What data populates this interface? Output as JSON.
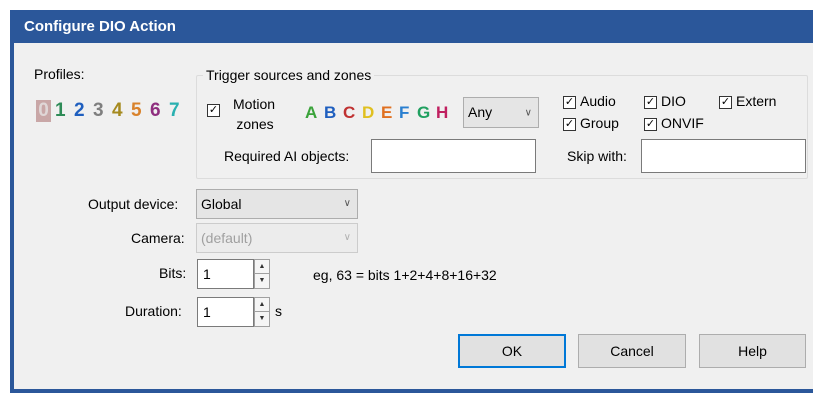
{
  "dialog": {
    "title": "Configure DIO Action"
  },
  "profiles": {
    "label": "Profiles:",
    "items": [
      {
        "label": "0",
        "color": "#e0d7d7",
        "selected": true
      },
      {
        "label": "1",
        "color": "#2e8b57"
      },
      {
        "label": "2",
        "color": "#1f5fbf"
      },
      {
        "label": "3",
        "color": "#7f7f7f"
      },
      {
        "label": "4",
        "color": "#a58a1f"
      },
      {
        "label": "5",
        "color": "#d9822b"
      },
      {
        "label": "6",
        "color": "#8f2f7f"
      },
      {
        "label": "7",
        "color": "#2ab0b0"
      }
    ]
  },
  "trigger": {
    "group_title": "Trigger sources and zones",
    "motion_zones": {
      "label_line1": "Motion",
      "label_line2": "zones",
      "checked": true
    },
    "zones": [
      {
        "label": "A",
        "color": "#3aa33a"
      },
      {
        "label": "B",
        "color": "#1f5fbf"
      },
      {
        "label": "C",
        "color": "#c03232"
      },
      {
        "label": "D",
        "color": "#e0c020"
      },
      {
        "label": "E",
        "color": "#e07020"
      },
      {
        "label": "F",
        "color": "#2a7fd0"
      },
      {
        "label": "G",
        "color": "#20a060"
      },
      {
        "label": "H",
        "color": "#c02060"
      }
    ],
    "zone_mode": {
      "value": "Any"
    },
    "sources": [
      {
        "label": "Audio",
        "checked": true
      },
      {
        "label": "DIO",
        "checked": true
      },
      {
        "label": "Extern",
        "checked": true
      },
      {
        "label": "Group",
        "checked": true
      },
      {
        "label": "ONVIF",
        "checked": true
      }
    ],
    "required_ai_label": "Required AI objects:",
    "required_ai_value": "",
    "skip_with_label": "Skip with:",
    "skip_with_value": ""
  },
  "output_device": {
    "label": "Output device:",
    "value": "Global"
  },
  "camera": {
    "label": "Camera:",
    "value": "(default)",
    "disabled": true
  },
  "bits": {
    "label": "Bits:",
    "value": "1",
    "hint": "eg, 63 = bits 1+2+4+8+16+32"
  },
  "duration": {
    "label": "Duration:",
    "value": "1",
    "unit": "s"
  },
  "buttons": {
    "ok": "OK",
    "cancel": "Cancel",
    "help": "Help"
  }
}
